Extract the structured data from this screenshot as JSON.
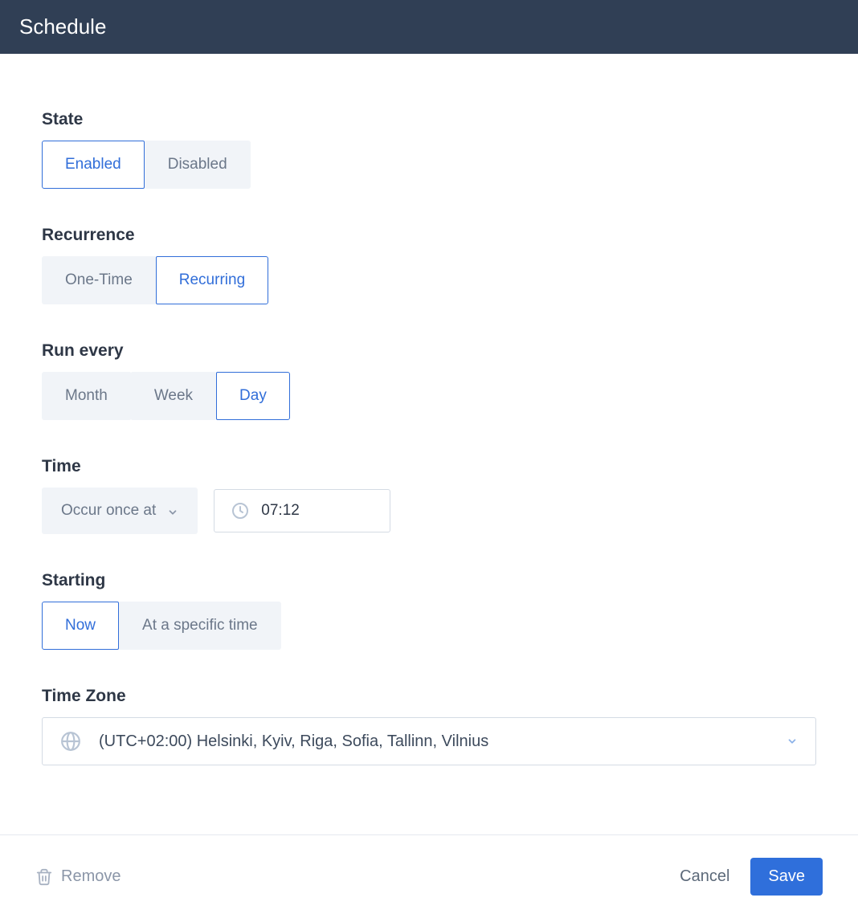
{
  "header": {
    "title": "Schedule"
  },
  "state": {
    "label": "State",
    "options": [
      "Enabled",
      "Disabled"
    ],
    "selected": "Enabled"
  },
  "recurrence": {
    "label": "Recurrence",
    "options": [
      "One-Time",
      "Recurring"
    ],
    "selected": "Recurring"
  },
  "runEvery": {
    "label": "Run every",
    "options": [
      "Month",
      "Week",
      "Day"
    ],
    "selected": "Day"
  },
  "time": {
    "label": "Time",
    "occurLabel": "Occur once at",
    "value": "07:12"
  },
  "starting": {
    "label": "Starting",
    "options": [
      "Now",
      "At a specific time"
    ],
    "selected": "Now"
  },
  "timezone": {
    "label": "Time Zone",
    "value": "(UTC+02:00) Helsinki, Kyiv, Riga, Sofia, Tallinn, Vilnius"
  },
  "footer": {
    "remove": "Remove",
    "cancel": "Cancel",
    "save": "Save"
  }
}
